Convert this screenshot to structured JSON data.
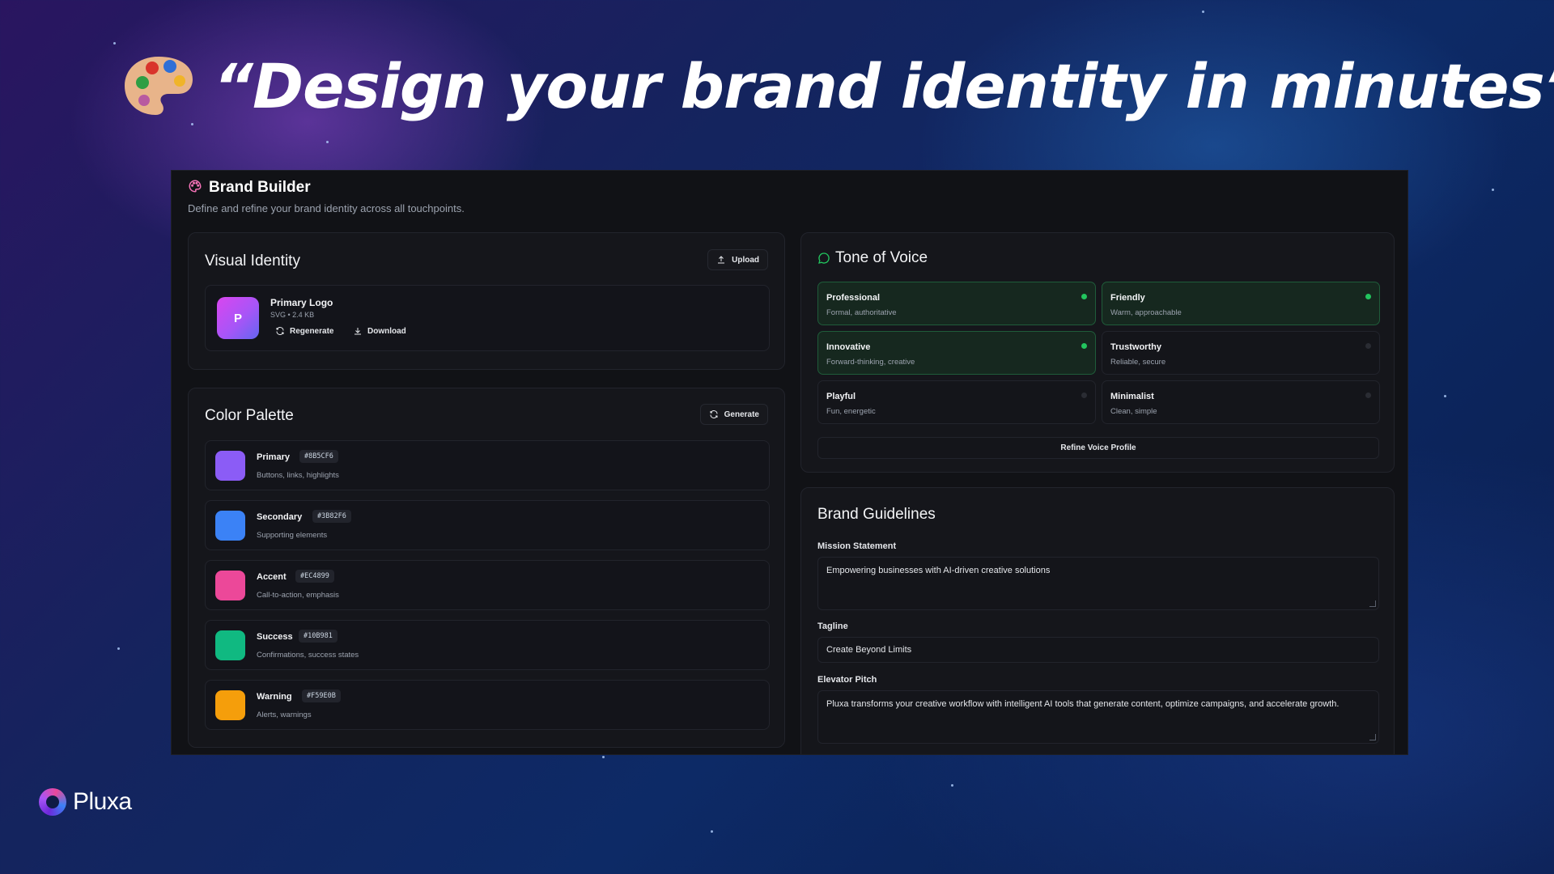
{
  "hero": {
    "emoji": "palette-emoji",
    "title": "“Design your brand identity in minutes”"
  },
  "app": {
    "title": "Brand Builder",
    "subtitle": "Define and refine your brand identity across all touchpoints."
  },
  "visual_identity": {
    "title": "Visual Identity",
    "upload_label": "Upload",
    "logo": {
      "letter": "P",
      "name": "Primary Logo",
      "meta": "SVG • 2.4 KB",
      "regenerate_label": "Regenerate",
      "download_label": "Download"
    }
  },
  "color_palette": {
    "title": "Color Palette",
    "generate_label": "Generate",
    "colors": [
      {
        "name": "Primary",
        "hex": "#8B5CF6",
        "desc": "Buttons, links, highlights"
      },
      {
        "name": "Secondary",
        "hex": "#3B82F6",
        "desc": "Supporting elements"
      },
      {
        "name": "Accent",
        "hex": "#EC4899",
        "desc": "Call-to-action, emphasis"
      },
      {
        "name": "Success",
        "hex": "#10B981",
        "desc": "Confirmations, success states"
      },
      {
        "name": "Warning",
        "hex": "#F59E0B",
        "desc": "Alerts, warnings"
      }
    ]
  },
  "tone_of_voice": {
    "title": "Tone of Voice",
    "options": [
      {
        "name": "Professional",
        "desc": "Formal, authoritative",
        "selected": true
      },
      {
        "name": "Friendly",
        "desc": "Warm, approachable",
        "selected": true
      },
      {
        "name": "Innovative",
        "desc": "Forward-thinking, creative",
        "selected": true
      },
      {
        "name": "Trustworthy",
        "desc": "Reliable, secure",
        "selected": false
      },
      {
        "name": "Playful",
        "desc": "Fun, energetic",
        "selected": false
      },
      {
        "name": "Minimalist",
        "desc": "Clean, simple",
        "selected": false
      }
    ],
    "refine_label": "Refine Voice Profile"
  },
  "brand_guidelines": {
    "title": "Brand Guidelines",
    "mission_label": "Mission Statement",
    "mission_value": "Empowering businesses with AI-driven creative solutions",
    "tagline_label": "Tagline",
    "tagline_value": "Create Beyond Limits",
    "pitch_label": "Elevator Pitch",
    "pitch_value": "Pluxa transforms your creative workflow with intelligent AI tools that generate content, optimize campaigns, and accelerate growth."
  },
  "footer": {
    "brand_name": "Pluxa"
  },
  "colors": {
    "selected_bg": "#16281F",
    "selected_dot": "#22C55E",
    "app_bg": "#111216"
  }
}
